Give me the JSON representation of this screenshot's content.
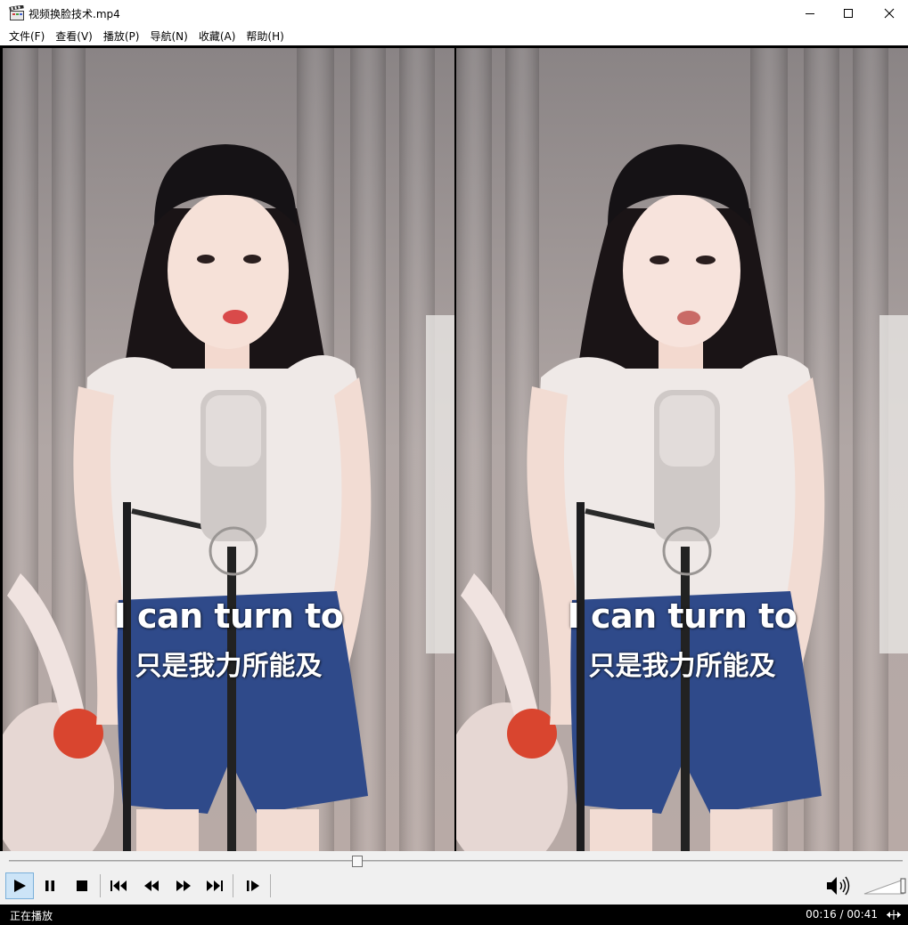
{
  "window": {
    "title": "视频换脸技术.mp4",
    "app_icon": "media-player-clapper-icon"
  },
  "menu": {
    "items": [
      {
        "label": "文件(F)"
      },
      {
        "label": "查看(V)"
      },
      {
        "label": "播放(P)"
      },
      {
        "label": "导航(N)"
      },
      {
        "label": "收藏(A)"
      },
      {
        "label": "帮助(H)"
      }
    ]
  },
  "video": {
    "subtitle_en": "I can turn to",
    "subtitle_zh": "只是我力所能及"
  },
  "playback": {
    "position_fraction": 0.39,
    "volume_fraction": 1.0,
    "controls": [
      "play-icon",
      "pause-icon",
      "stop-icon",
      "skip-previous-icon",
      "rewind-icon",
      "fast-forward-icon",
      "skip-next-icon",
      "frame-step-icon"
    ]
  },
  "status": {
    "state": "正在播放",
    "time": "00:16 / 00:41"
  },
  "colors": {
    "accent": "#cce4f7",
    "status_bg": "#000000",
    "controls_bg": "#f0f0f0"
  }
}
